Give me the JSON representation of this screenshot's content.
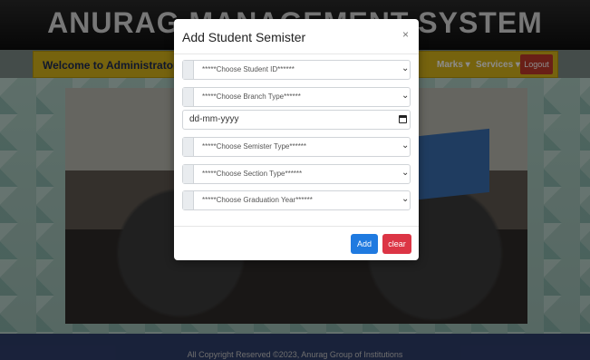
{
  "app": {
    "title": "ANURAG MANAGEMENT SYSTEM"
  },
  "navbar": {
    "welcome": "Welcome to Administrator!",
    "items": [
      "Marks ▾",
      "Services ▾"
    ],
    "logout": "Logout"
  },
  "footer": {
    "text": "All Copyright Reserved ©2023, Anurag Group of Institutions"
  },
  "modal": {
    "title": "Add Student Semister",
    "close": "×",
    "fields": [
      {
        "label": "*****Choose Student ID******",
        "type": "select"
      },
      {
        "label": "*****Choose Branch Type******",
        "type": "select"
      },
      {
        "label": "dd-mm-yyyy",
        "type": "date"
      },
      {
        "label": "*****Choose Semister Type******",
        "type": "select"
      },
      {
        "label": "*****Choose Section Type******",
        "type": "select"
      },
      {
        "label": "*****Choose Graduation Year******",
        "type": "select"
      }
    ],
    "add_label": "Add",
    "clear_label": "clear"
  },
  "colors": {
    "navbar": "#d8b51a",
    "add_button": "#1f7ae0",
    "clear_button": "#dc3545",
    "footer": "#2f3e6b"
  }
}
